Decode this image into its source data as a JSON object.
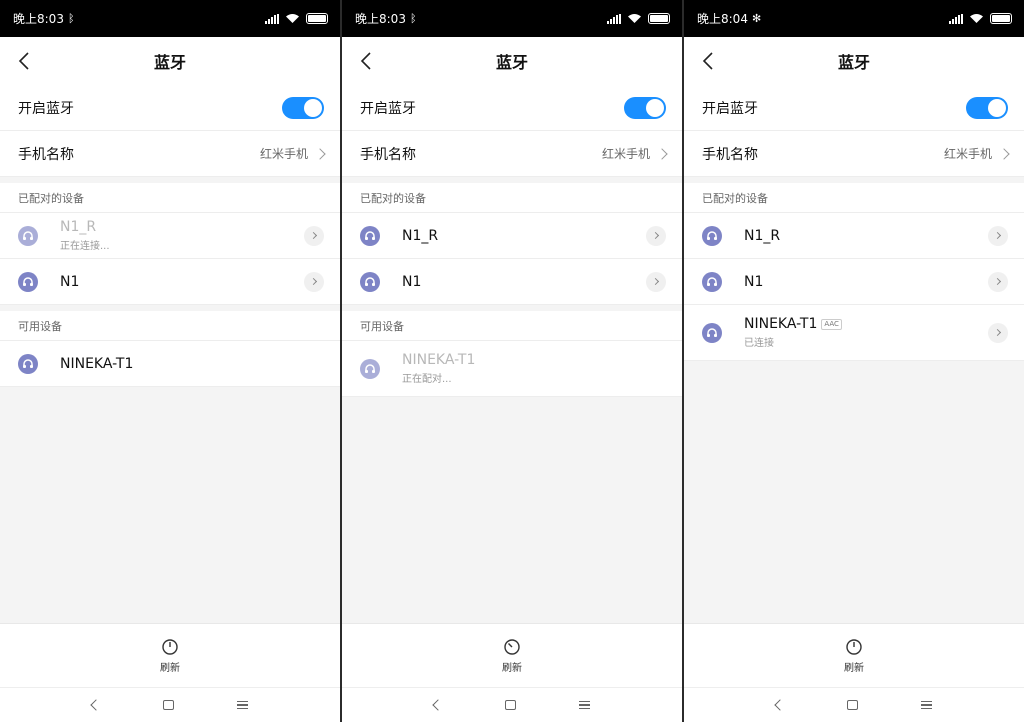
{
  "screens": [
    {
      "status": {
        "time": "晚上8:03",
        "bt_icon": "ᛒ"
      },
      "title": "蓝牙",
      "bluetooth_toggle_label": "开启蓝牙",
      "phone_name_label": "手机名称",
      "phone_name_value": "红米手机",
      "paired_section": "已配对的设备",
      "paired": [
        {
          "name": "N1_R",
          "sub": "正在连接..."
        },
        {
          "name": "N1"
        }
      ],
      "available_section": "可用设备",
      "available": [
        {
          "name": "NINEKA-T1"
        }
      ],
      "refresh_label": "刷新"
    },
    {
      "status": {
        "time": "晚上8:03",
        "bt_icon": "ᛒ"
      },
      "title": "蓝牙",
      "bluetooth_toggle_label": "开启蓝牙",
      "phone_name_label": "手机名称",
      "phone_name_value": "红米手机",
      "paired_section": "已配对的设备",
      "paired": [
        {
          "name": "N1_R"
        },
        {
          "name": "N1"
        }
      ],
      "available_section": "可用设备",
      "available": [
        {
          "name": "NINEKA-T1",
          "sub": "正在配对..."
        }
      ],
      "refresh_label": "刷新"
    },
    {
      "status": {
        "time": "晚上8:04",
        "bt_icon": "✻"
      },
      "title": "蓝牙",
      "bluetooth_toggle_label": "开启蓝牙",
      "phone_name_label": "手机名称",
      "phone_name_value": "红米手机",
      "paired_section": "已配对的设备",
      "paired": [
        {
          "name": "N1_R"
        },
        {
          "name": "N1"
        },
        {
          "name": "NINEKA-T1",
          "badge": "AAC",
          "sub": "已连接"
        }
      ],
      "refresh_label": "刷新"
    }
  ],
  "colors": {
    "toggle_on": "#1a8fff",
    "device_icon": "#7e84c6"
  },
  "icons": {
    "back": "back-chevron-icon",
    "device": "headset-icon",
    "refresh": "refresh-icon"
  }
}
